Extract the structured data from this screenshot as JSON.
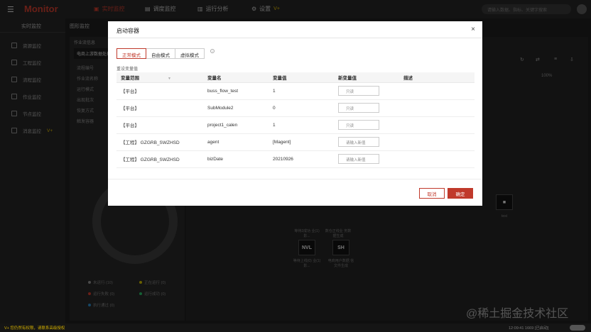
{
  "topbar": {
    "logo": "Monitor",
    "nav": [
      {
        "label": "实时监控",
        "active": true
      },
      {
        "label": "调度监控",
        "active": false
      },
      {
        "label": "运行分析",
        "active": false
      },
      {
        "label": "设置",
        "active": false,
        "badge": "V+"
      }
    ],
    "search_placeholder": "请输入数据、指标、关键字搜索"
  },
  "sidebar": {
    "title": "实时监控",
    "items": [
      {
        "label": "资源监控"
      },
      {
        "label": "工程监控"
      },
      {
        "label": "流程监控"
      },
      {
        "label": "作业监控"
      },
      {
        "label": "节点监控"
      },
      {
        "label": "消息监控",
        "badge": "V+"
      }
    ]
  },
  "main": {
    "title": "图形监控",
    "panel_header": "作业流信息",
    "panel_tab": "电商上游数据处理",
    "fields": [
      "流程编号",
      "作业流名称",
      "运行模式",
      "出现批次",
      "恢复方式",
      "触发容器"
    ],
    "legend": [
      {
        "label": "未运行 (10)",
        "color": "#888888"
      },
      {
        "label": "正在运行 (0)",
        "color": "#c0b000"
      },
      {
        "label": "运行失败 (0)",
        "color": "#c0392b"
      },
      {
        "label": "运行成功 (0)",
        "color": "#27ae60"
      },
      {
        "label": "执行通过 (0)",
        "color": "#2980b9"
      }
    ],
    "zoom": "100%",
    "nodes": [
      {
        "label": "NVL",
        "caption": "等待上线(0) 业(1)影..."
      },
      {
        "label": "SH",
        "caption": "电商用户数据 信文件生成"
      }
    ],
    "node_captions_top": [
      "等待2成功 业(1)影...",
      "数仓正线业 务数据生成"
    ],
    "right_node_caption": "test"
  },
  "modal": {
    "title": "启动容器",
    "close": "×",
    "tabs": [
      {
        "label": "正常模式",
        "active": true
      },
      {
        "label": "自由模式",
        "active": false
      },
      {
        "label": "虚拟模式",
        "active": false
      }
    ],
    "section_label": "重设变量值",
    "columns": [
      "变量范围",
      "变量名",
      "变量值",
      "新变量值",
      "描述"
    ],
    "rows": [
      {
        "scope": "【平台】",
        "name": "buss_flow_test",
        "value": "1",
        "new_placeholder": "只读",
        "desc": ""
      },
      {
        "scope": "【平台】",
        "name": "SubModule2",
        "value": "0",
        "new_placeholder": "只读",
        "desc": ""
      },
      {
        "scope": "【平台】",
        "name": "project1_calen",
        "value": "1",
        "new_placeholder": "只读",
        "desc": ""
      },
      {
        "scope": "【工程】 GZGRB_SWZHSD",
        "name": "agent",
        "value": "[Magent]",
        "new_placeholder": "请输入新值",
        "desc": ""
      },
      {
        "scope": "【工程】 GZGRB_SWZHSD",
        "name": "bizDate",
        "value": "20210926",
        "new_placeholder": "请输入新值",
        "desc": ""
      }
    ],
    "cancel_label": "取消",
    "ok_label": "确定"
  },
  "status": {
    "left": "V+ 您仍然有权限，请联系高级授权",
    "right": "12:09:41 1669 [已启动]"
  },
  "watermark": "@稀土掘金技术社区",
  "colors": {
    "accent": "#c0392b",
    "vplus": "#d4b000"
  }
}
